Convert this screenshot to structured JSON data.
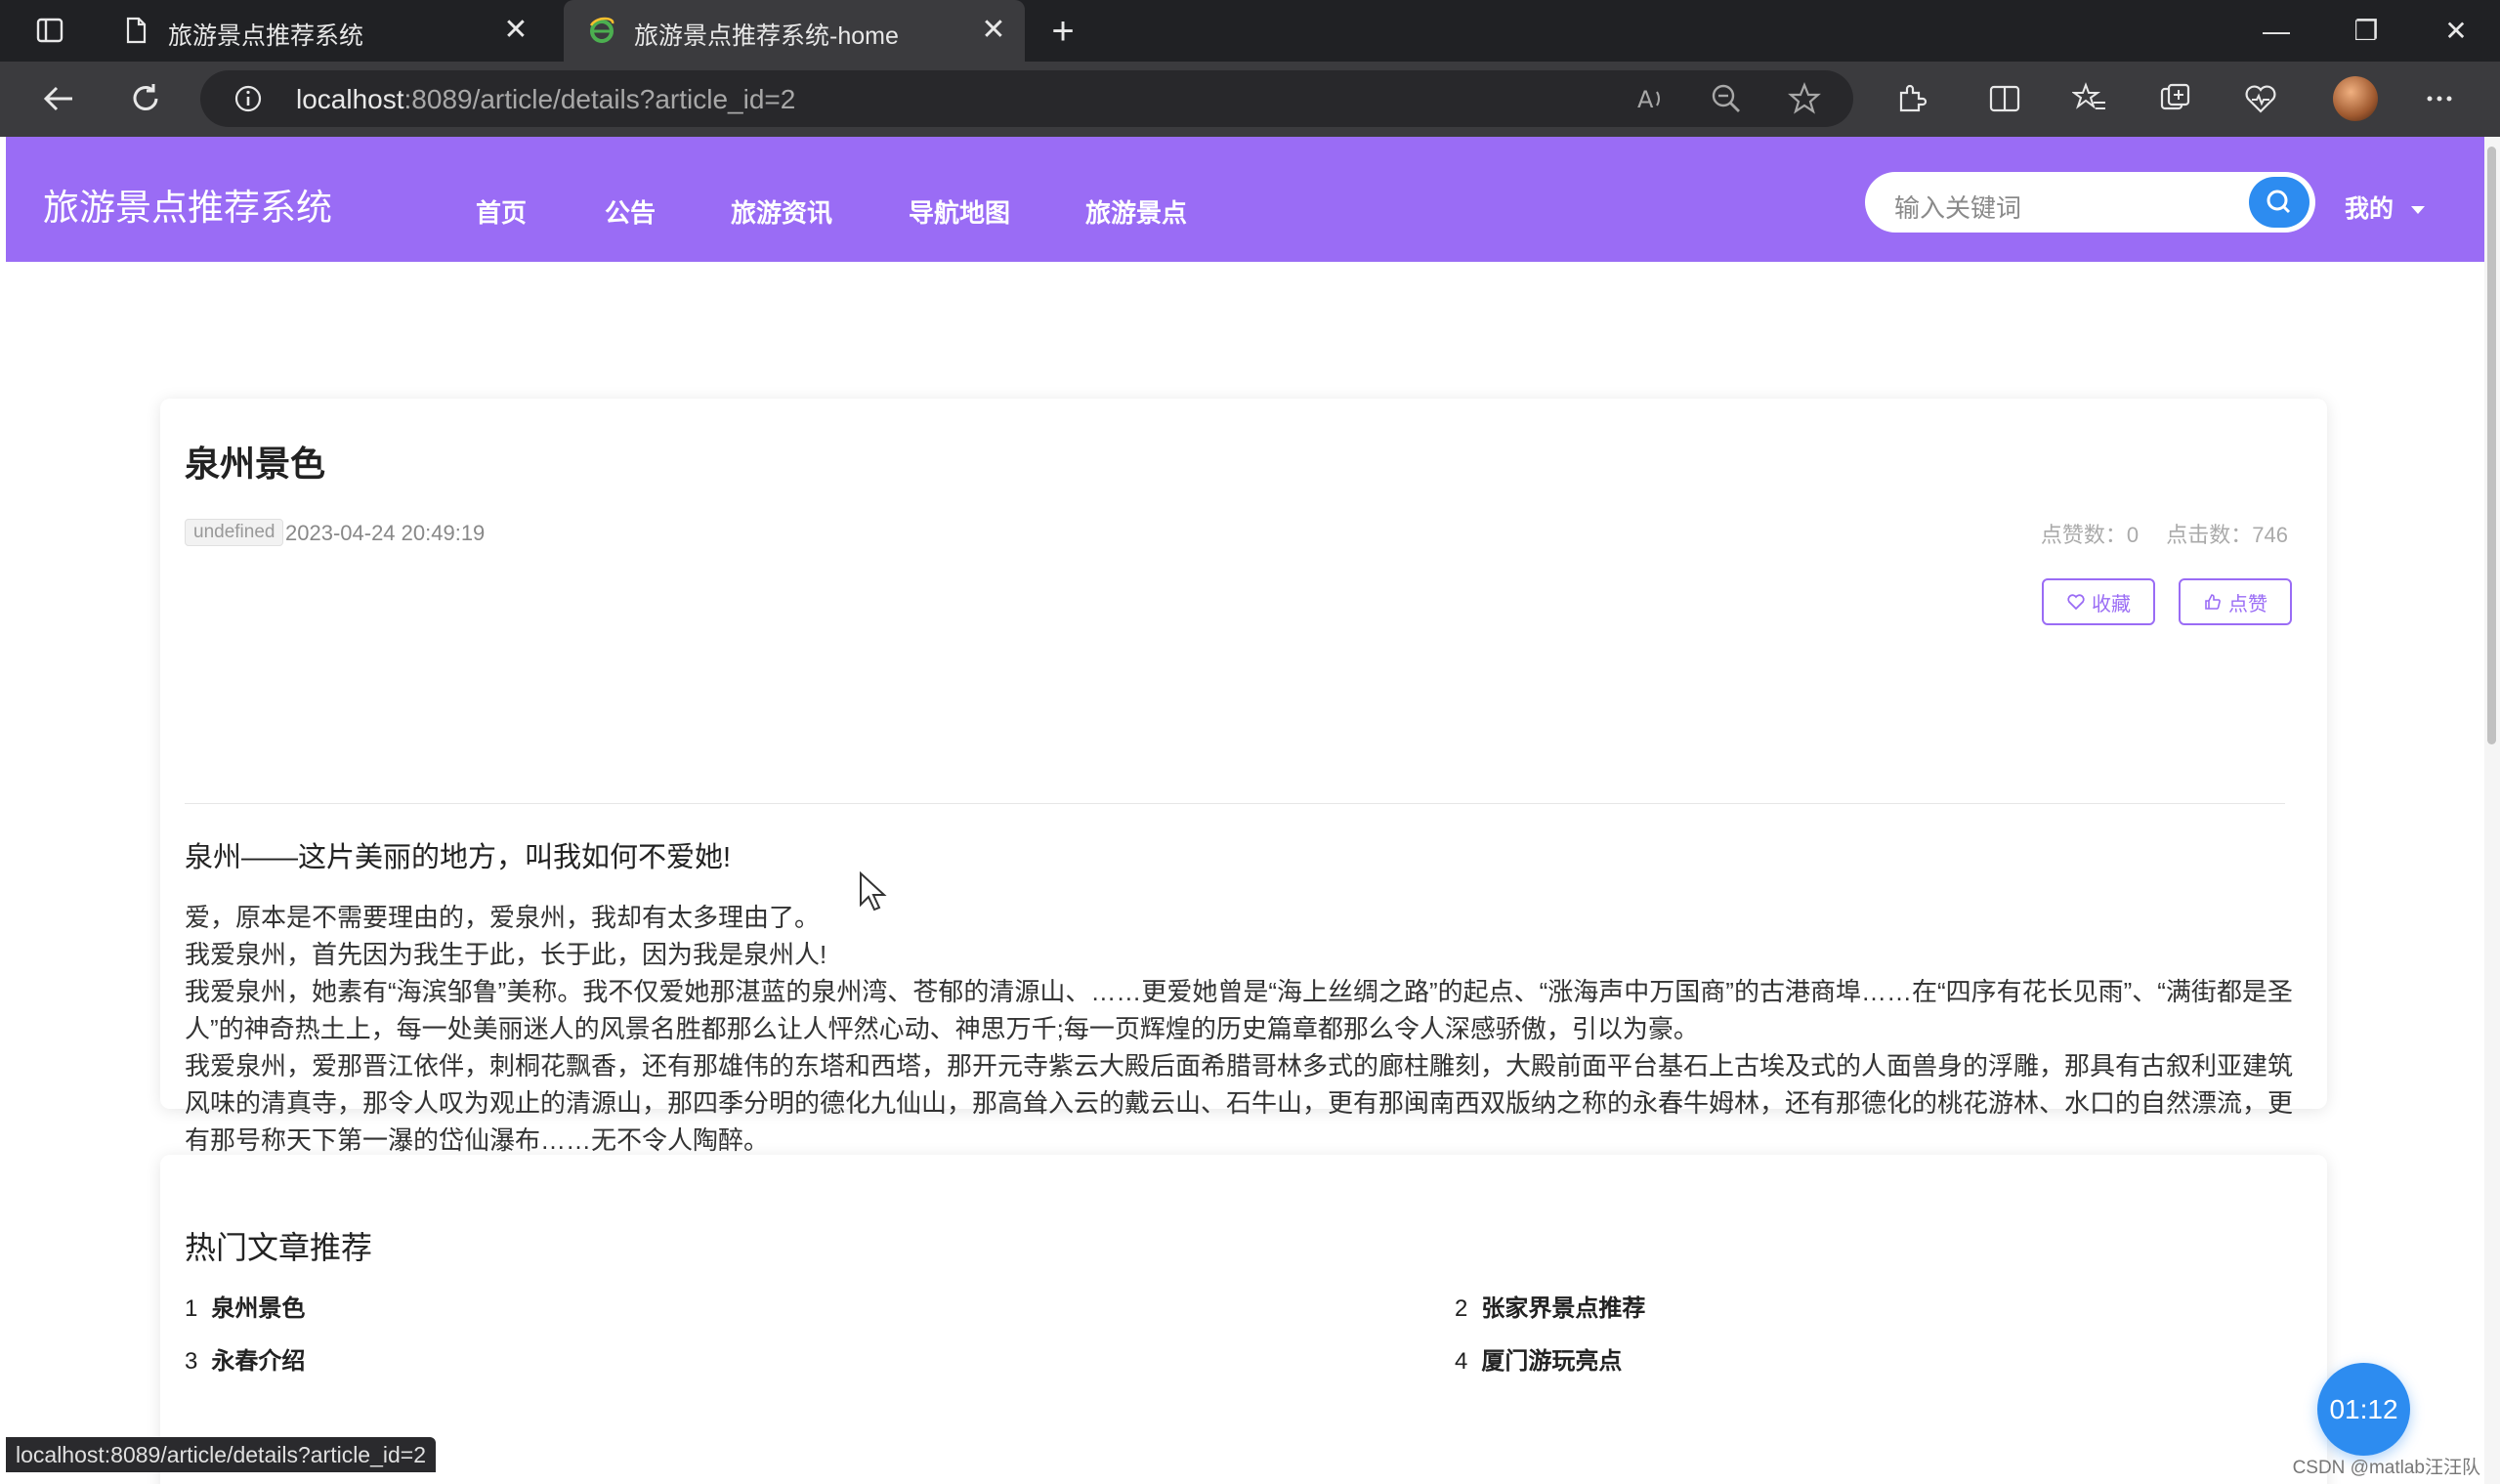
{
  "browser": {
    "tabs": [
      {
        "title": "旅游景点推荐系统",
        "active": false
      },
      {
        "title": "旅游景点推荐系统-home",
        "active": true
      }
    ],
    "url_host": "localhost",
    "url_rest": ":8089/article/details?article_id=2",
    "status_url": "localhost:8089/article/details?article_id=2"
  },
  "header": {
    "logo": "旅游景点推荐系统",
    "nav": [
      "首页",
      "公告",
      "旅游资讯",
      "导航地图",
      "旅游景点"
    ],
    "search_placeholder": "输入关键词",
    "user_menu": "我的"
  },
  "article": {
    "title": "泉州景色",
    "tag": "undefined",
    "date": "2023-04-24 20:49:19",
    "likes_label": "点赞数：0",
    "clicks_label": "点击数：746",
    "favorite_label": "收藏",
    "like_label": "点赞",
    "lead": "泉州——这片美丽的地方，叫我如何不爱她!",
    "paragraphs": [
      "爱，原本是不需要理由的，爱泉州，我却有太多理由了。",
      "我爱泉州，首先因为我生于此，长于此，因为我是泉州人!",
      "我爱泉州，她素有“海滨邹鲁”美称。我不仅爱她那湛蓝的泉州湾、苍郁的清源山、……更爱她曾是“海上丝绸之路”的起点、“涨海声中万国商”的古港商埠……在“四序有花长见雨”、“满街都是圣人”的神奇热土上，每一处美丽迷人的风景名胜都那么让人怦然心动、神思万千;每一页辉煌的历史篇章都那么令人深感骄傲，引以为豪。",
      "我爱泉州，爱那晋江依伴，刺桐花飘香，还有那雄伟的东塔和西塔，那开元寺紫云大殿后面希腊哥林多式的廊柱雕刻，大殿前面平台基石上古埃及式的人面兽身的浮雕，那具有古叙利亚建筑风味的清真寺，那令人叹为观止的清源山，那四季分明的德化九仙山，那高耸入云的戴云山、石牛山，更有那闽南西双版纳之称的永春牛姆林，还有那德化的桃花游林、水口的自然漂流，更有那号称天下第一瀑的岱仙瀑布……无不令人陶醉。"
    ]
  },
  "hot": {
    "title": "热门文章推荐",
    "items": [
      {
        "num": "1",
        "text": "泉州景色"
      },
      {
        "num": "2",
        "text": "张家界景点推荐"
      },
      {
        "num": "3",
        "text": "永春介绍"
      },
      {
        "num": "4",
        "text": "厦门游玩亮点"
      }
    ]
  },
  "timer": "01:12",
  "watermark": "CSDN @matlab汪汪队",
  "colors": {
    "accent": "#9a6cf5",
    "search_button": "#2d8cf0"
  }
}
